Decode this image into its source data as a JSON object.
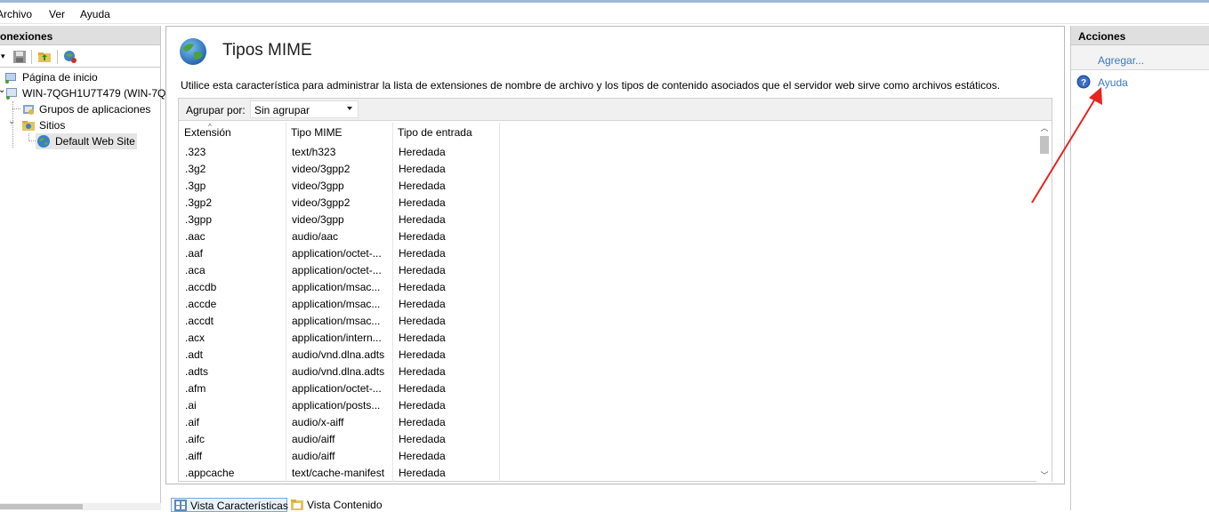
{
  "menu": {
    "file": "Archivo",
    "view": "Ver",
    "help": "Ayuda"
  },
  "connections": {
    "title": "onexiones",
    "tree": {
      "start_page": "Página de inicio",
      "server": "WIN-7QGH1U7T479 (WIN-7Q",
      "app_pools": "Grupos de aplicaciones",
      "sites": "Sitios",
      "default_site": "Default Web Site"
    }
  },
  "feature": {
    "title": "Tipos MIME",
    "description": "Utilice esta característica para administrar la lista de extensiones de nombre de archivo y los tipos de contenido asociados que el servidor web sirve como archivos estáticos.",
    "group_by_label": "Agrupar por:",
    "group_by_value": "Sin agrupar",
    "columns": {
      "extension": "Extensión",
      "mime": "Tipo MIME",
      "entry": "Tipo de entrada"
    },
    "rows": [
      {
        "ext": ".323",
        "mime": "text/h323",
        "entry": "Heredada"
      },
      {
        "ext": ".3g2",
        "mime": "video/3gpp2",
        "entry": "Heredada"
      },
      {
        "ext": ".3gp",
        "mime": "video/3gpp",
        "entry": "Heredada"
      },
      {
        "ext": ".3gp2",
        "mime": "video/3gpp2",
        "entry": "Heredada"
      },
      {
        "ext": ".3gpp",
        "mime": "video/3gpp",
        "entry": "Heredada"
      },
      {
        "ext": ".aac",
        "mime": "audio/aac",
        "entry": "Heredada"
      },
      {
        "ext": ".aaf",
        "mime": "application/octet-...",
        "entry": "Heredada"
      },
      {
        "ext": ".aca",
        "mime": "application/octet-...",
        "entry": "Heredada"
      },
      {
        "ext": ".accdb",
        "mime": "application/msac...",
        "entry": "Heredada"
      },
      {
        "ext": ".accde",
        "mime": "application/msac...",
        "entry": "Heredada"
      },
      {
        "ext": ".accdt",
        "mime": "application/msac...",
        "entry": "Heredada"
      },
      {
        "ext": ".acx",
        "mime": "application/intern...",
        "entry": "Heredada"
      },
      {
        "ext": ".adt",
        "mime": "audio/vnd.dlna.adts",
        "entry": "Heredada"
      },
      {
        "ext": ".adts",
        "mime": "audio/vnd.dlna.adts",
        "entry": "Heredada"
      },
      {
        "ext": ".afm",
        "mime": "application/octet-...",
        "entry": "Heredada"
      },
      {
        "ext": ".ai",
        "mime": "application/posts...",
        "entry": "Heredada"
      },
      {
        "ext": ".aif",
        "mime": "audio/x-aiff",
        "entry": "Heredada"
      },
      {
        "ext": ".aifc",
        "mime": "audio/aiff",
        "entry": "Heredada"
      },
      {
        "ext": ".aiff",
        "mime": "audio/aiff",
        "entry": "Heredada"
      },
      {
        "ext": ".appcache",
        "mime": "text/cache-manifest",
        "entry": "Heredada"
      }
    ]
  },
  "view_tabs": {
    "features": "Vista Características",
    "content": "Vista Contenido"
  },
  "actions": {
    "title": "Acciones",
    "add": "Agregar...",
    "help": "Ayuda"
  },
  "colors": {
    "link": "#3b78c3",
    "annotation_arrow": "#e8231f",
    "header_bg": "#dfdfdf"
  }
}
